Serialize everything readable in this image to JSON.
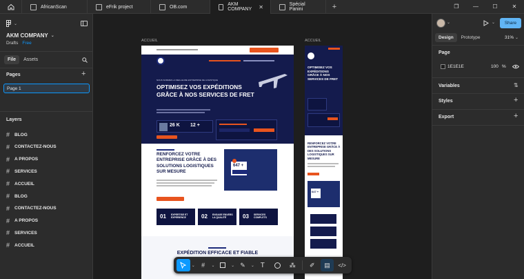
{
  "tabs": [
    {
      "label": "AfricanScan",
      "active": false,
      "closable": false
    },
    {
      "label": "eFrik project",
      "active": false,
      "closable": false
    },
    {
      "label": "OB.com",
      "active": false,
      "closable": false
    },
    {
      "label": "AKM COMPANY",
      "active": true,
      "closable": true
    },
    {
      "label": "Spécial Panini",
      "active": false,
      "closable": false
    }
  ],
  "project": {
    "name": "AKM COMPANY",
    "drafts": "Drafts",
    "plan": "Free"
  },
  "left_tabs": {
    "file": "File",
    "assets": "Assets"
  },
  "pages": {
    "title": "Pages",
    "items": [
      "Page 1"
    ]
  },
  "layers": {
    "title": "Layers",
    "items": [
      "BLOG",
      "CONTACTEZ-NOUS",
      "A PROPOS",
      "SERVICES",
      "ACCUEIL",
      "BLOG",
      "CONTACTEZ-NOUS",
      "A PROPOS",
      "SERVICES",
      "ACCUEIL"
    ]
  },
  "canvas": {
    "frame_labels": [
      "ACCUEIL",
      "ACCUEIL"
    ],
    "hero_title": "OPTIMISEZ VOS EXPÉDITIONS GRÂCE À NOS SERVICES DE FRET",
    "hero_kicker": "NOUS SOMMES LA MEILLEURE ENTREPRISE DE LOGISTIQUE",
    "stat1": "26 K",
    "stat2": "12 +",
    "section2_title": "RENFORCEZ VOTRE ENTREPRISE GRÂCE À DES SOLUTIONS LOGISTIQUES SUR MESURE",
    "badge_value": "647 +",
    "features": [
      {
        "num": "01",
        "label": "EXPERTISE ET EXPERIENCE"
      },
      {
        "num": "02",
        "label": "ENGAGE ENVERS LA QUALITÉ"
      },
      {
        "num": "03",
        "label": "SERVICES COMPLETS"
      }
    ],
    "section3_title": "EXPÉDITION EFFICACE ET FIABLE",
    "mobile_title": "OPTIMISEZ VOS EXPÉDITIONS GRÂCE À NOS SERVICES DE FRET",
    "mobile_section2": "RENFORCEZ VOTRE ENTREPRISE GRÂCE À DES SOLUTIONS LOGISTIQUES SUR MESURE",
    "mobile_badge": "647 +"
  },
  "right": {
    "design": "Design",
    "prototype": "Prototype",
    "zoom": "31%",
    "share": "Share",
    "page_section": "Page",
    "bg_hex": "1E1E1E",
    "opacity": "100",
    "opacity_unit": "%",
    "variables": "Variables",
    "styles": "Styles",
    "export": "Export"
  },
  "colors": {
    "accent": "#0d99ff",
    "navy": "#141b4d",
    "orange": "#e8541e",
    "share": "#61b5f5"
  }
}
